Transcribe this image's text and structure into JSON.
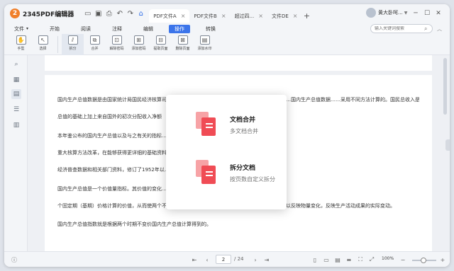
{
  "app": {
    "logo": "2",
    "title": "2345PDF编辑器"
  },
  "quick_access": {
    "folder_icon": "folder-icon",
    "open_icon": "open-folder-icon",
    "print_icon": "print-icon",
    "undo_icon": "undo-icon",
    "redo_icon": "redo-icon",
    "home_icon": "home-icon"
  },
  "tabs": [
    {
      "label": "PDF文件A",
      "active": true
    },
    {
      "label": "PDF文件B",
      "active": false
    },
    {
      "label": "超过四...",
      "active": false
    },
    {
      "label": "文件DE",
      "active": false
    }
  ],
  "user": {
    "name": "黄大卧呵...",
    "has_dropdown": true
  },
  "window_controls": [
    "minimize",
    "maximize",
    "close"
  ],
  "menu": {
    "items": [
      {
        "label": "文件",
        "caret": "▾",
        "active": false
      },
      {
        "label": "开始",
        "active": false
      },
      {
        "label": "阅读",
        "active": false
      },
      {
        "label": "注释",
        "active": false
      },
      {
        "label": "编辑",
        "active": false
      },
      {
        "label": "操作",
        "active": true
      },
      {
        "label": "转换",
        "active": false
      }
    ],
    "search_placeholder": "输入关键词搜索"
  },
  "ribbon": [
    {
      "label": "手型",
      "icon": "hand-icon"
    },
    {
      "label": "选择",
      "icon": "cursor-icon"
    },
    {
      "label": "拆分",
      "icon": "split-icon",
      "selected": true
    },
    {
      "label": "合并",
      "icon": "merge-icon"
    },
    {
      "label": "解除密码",
      "icon": "unlock-icon"
    },
    {
      "label": "添加密码",
      "icon": "lock-icon"
    },
    {
      "label": "提取页面",
      "icon": "extract-page-icon"
    },
    {
      "label": "删除页面",
      "icon": "delete-page-icon"
    },
    {
      "label": "添加水印",
      "icon": "watermark-icon"
    }
  ],
  "sidebar": [
    "search-icon",
    "thumbnails-icon",
    "comments-icon",
    "outline-icon",
    "bookmark-icon"
  ],
  "document": {
    "paragraphs": [
      "国内生产总值数据是由国家统计局国民经济核算司负责发布的……，主要采用按照收入法和支出法核算……国内生产总值数据……采用不同方法计算的。国民总收入是在国内生产",
      "总值的基础上加上来自国外的初次分配收入净额",
      "本年鉴公布的国内生产总值以及与之有关的指标……数据记录等资料后发生变动。如果遇到普查或者",
      "重大核算方法改革，在能够获得更详细的基础资料……第四次全国经济普查年份，国家统计局依据",
      "经济普查数据和相关部门资料，修订了1952年以……",
      "国内生产总值是一个价值量指标。其价值的变化……把按当期价格计算的国内生产总值换算成按某",
      "个固定期（基期）价格计算的价值，从而使两个不同时期的价值进行比较时，能够剔除价格变化的影响，以反映物量变化，反映生产活动成果的实际变动。",
      "国内生产总值指数就是根据两个时期不变价国内生产总值计算得到的。"
    ]
  },
  "popup": [
    {
      "title": "文档合并",
      "subtitle": "多文档合并",
      "icon": "merge-document-icon"
    },
    {
      "title": "拆分文档",
      "subtitle": "按页数自定义拆分",
      "icon": "split-document-icon"
    }
  ],
  "status": {
    "current_page": "2",
    "total_pages": "/ 24",
    "zoom": "100%",
    "zoom_level": 1.0
  },
  "colors": {
    "accent": "#3b74ea",
    "popup_icon": "#f04c55",
    "logo": "#f07f2a"
  }
}
